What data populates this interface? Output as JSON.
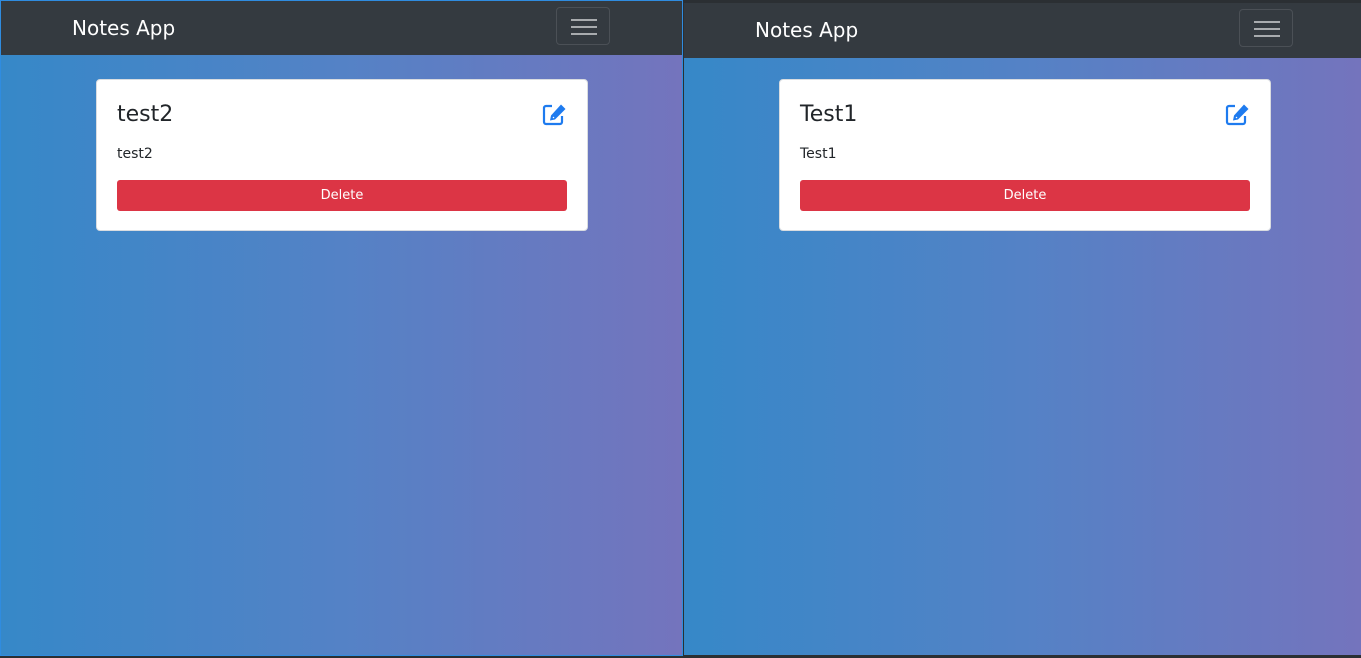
{
  "windows": [
    {
      "brand": "Notes App",
      "note": {
        "title": "test2",
        "body": "test2",
        "delete_label": "Delete"
      }
    },
    {
      "brand": "Notes App",
      "note": {
        "title": "Test1",
        "body": "Test1",
        "delete_label": "Delete"
      }
    }
  ],
  "icons": {
    "edit": "edit-icon",
    "menu": "hamburger-menu-icon"
  },
  "colors": {
    "navbar": "#343a40",
    "gradient_start": "#3688c8",
    "gradient_end": "#7474bd",
    "danger": "#dc3545",
    "accent": "#1e7bef"
  }
}
